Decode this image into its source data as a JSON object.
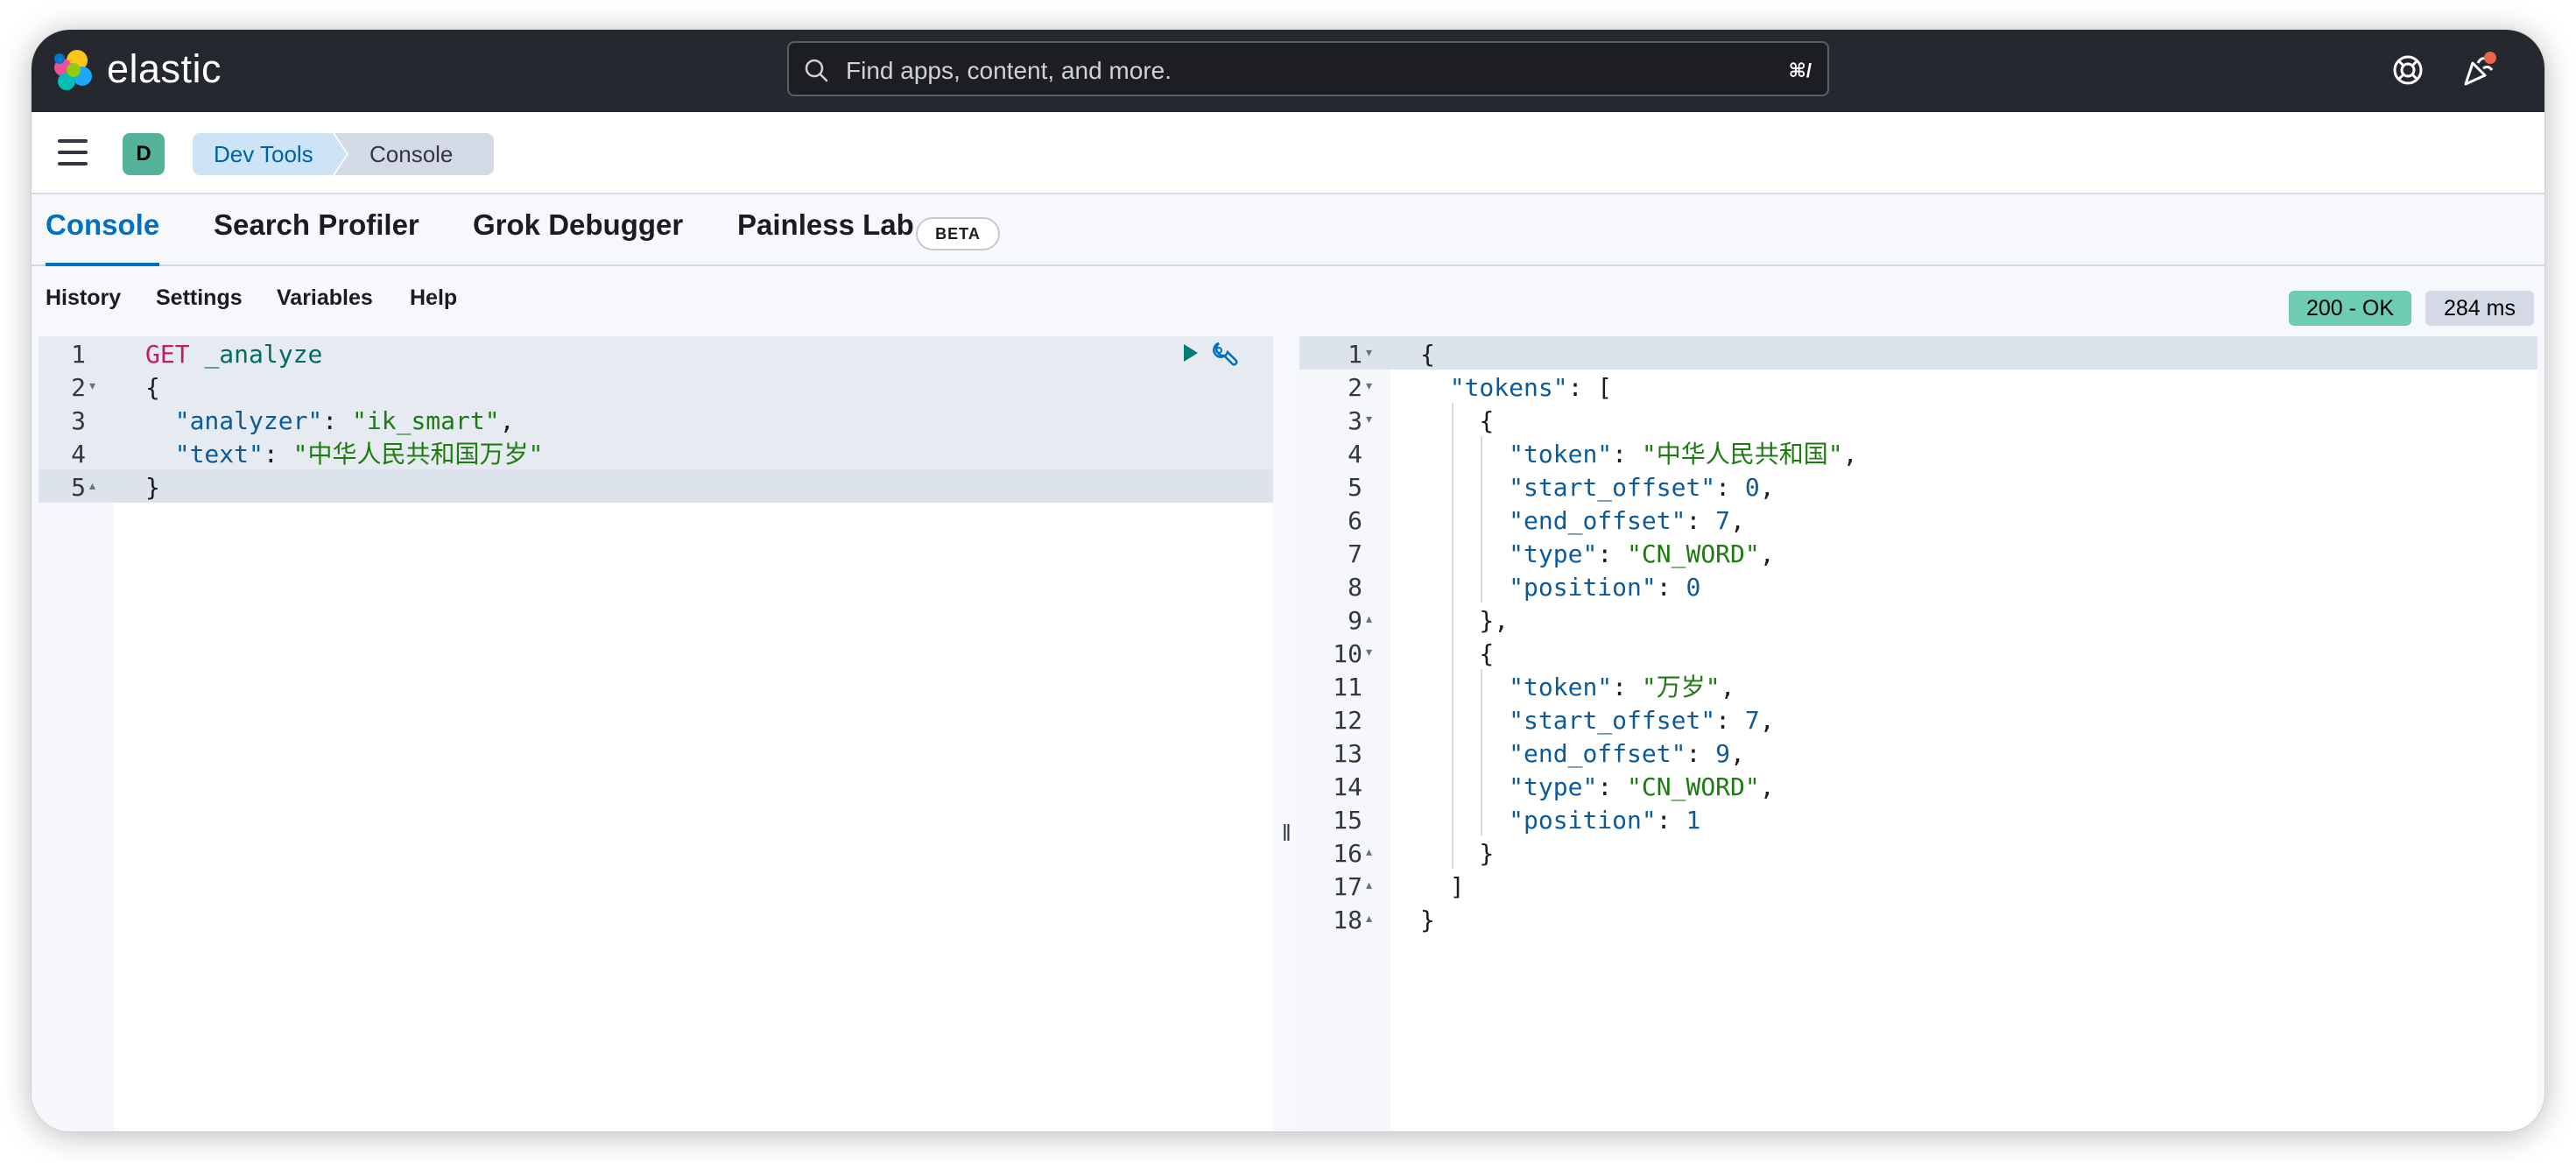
{
  "header": {
    "logo_text": "elastic",
    "search_placeholder": "Find apps, content, and more.",
    "search_shortcut": "⌘/",
    "colors": {
      "bar": "#25282f",
      "notification_dot": "#e7664c"
    }
  },
  "breadcrumb": {
    "space_initial": "D",
    "items": [
      "Dev Tools",
      "Console"
    ]
  },
  "tabs": [
    {
      "label": "Console",
      "active": true
    },
    {
      "label": "Search Profiler",
      "active": false
    },
    {
      "label": "Grok Debugger",
      "active": false
    },
    {
      "label": "Painless Lab",
      "active": false,
      "badge": "BETA"
    }
  ],
  "toolbar": {
    "items": [
      "History",
      "Settings",
      "Variables",
      "Help"
    ],
    "status_label": "200 - OK",
    "time_label": "284 ms",
    "colors": {
      "status": "#6dccb1",
      "time": "#d3dae6"
    }
  },
  "request_editor": {
    "line_numbers": [
      "1",
      "2",
      "3",
      "4",
      "5"
    ],
    "lines": [
      [
        {
          "t": "GET",
          "c": "k-method"
        },
        {
          "t": " ",
          "c": "k-punct"
        },
        {
          "t": "_analyze",
          "c": "k-path"
        }
      ],
      [
        {
          "t": "{",
          "c": "k-punct"
        }
      ],
      [
        {
          "t": "  ",
          "c": "k-punct"
        },
        {
          "t": "\"analyzer\"",
          "c": "k-key"
        },
        {
          "t": ": ",
          "c": "k-punct"
        },
        {
          "t": "\"ik_smart\"",
          "c": "k-str"
        },
        {
          "t": ",",
          "c": "k-punct"
        }
      ],
      [
        {
          "t": "  ",
          "c": "k-punct"
        },
        {
          "t": "\"text\"",
          "c": "k-key"
        },
        {
          "t": ": ",
          "c": "k-punct"
        },
        {
          "t": "\"中华人民共和国万岁\"",
          "c": "k-str"
        }
      ],
      [
        {
          "t": "}",
          "c": "k-punct"
        }
      ]
    ]
  },
  "response_editor": {
    "line_numbers": [
      "1",
      "2",
      "3",
      "4",
      "5",
      "6",
      "7",
      "8",
      "9",
      "10",
      "11",
      "12",
      "13",
      "14",
      "15",
      "16",
      "17",
      "18"
    ],
    "lines": [
      [
        {
          "t": "{",
          "c": "k-punct"
        }
      ],
      [
        {
          "t": "  ",
          "c": "k-punct"
        },
        {
          "t": "\"tokens\"",
          "c": "k-key"
        },
        {
          "t": ": [",
          "c": "k-punct"
        }
      ],
      [
        {
          "t": "    {",
          "c": "k-punct"
        }
      ],
      [
        {
          "t": "      ",
          "c": "k-punct"
        },
        {
          "t": "\"token\"",
          "c": "k-key"
        },
        {
          "t": ": ",
          "c": "k-punct"
        },
        {
          "t": "\"中华人民共和国\"",
          "c": "k-str"
        },
        {
          "t": ",",
          "c": "k-punct"
        }
      ],
      [
        {
          "t": "      ",
          "c": "k-punct"
        },
        {
          "t": "\"start_offset\"",
          "c": "k-key"
        },
        {
          "t": ": ",
          "c": "k-punct"
        },
        {
          "t": "0",
          "c": "k-num"
        },
        {
          "t": ",",
          "c": "k-punct"
        }
      ],
      [
        {
          "t": "      ",
          "c": "k-punct"
        },
        {
          "t": "\"end_offset\"",
          "c": "k-key"
        },
        {
          "t": ": ",
          "c": "k-punct"
        },
        {
          "t": "7",
          "c": "k-num"
        },
        {
          "t": ",",
          "c": "k-punct"
        }
      ],
      [
        {
          "t": "      ",
          "c": "k-punct"
        },
        {
          "t": "\"type\"",
          "c": "k-key"
        },
        {
          "t": ": ",
          "c": "k-punct"
        },
        {
          "t": "\"CN_WORD\"",
          "c": "k-str"
        },
        {
          "t": ",",
          "c": "k-punct"
        }
      ],
      [
        {
          "t": "      ",
          "c": "k-punct"
        },
        {
          "t": "\"position\"",
          "c": "k-key"
        },
        {
          "t": ": ",
          "c": "k-punct"
        },
        {
          "t": "0",
          "c": "k-num"
        }
      ],
      [
        {
          "t": "    },",
          "c": "k-punct"
        }
      ],
      [
        {
          "t": "    {",
          "c": "k-punct"
        }
      ],
      [
        {
          "t": "      ",
          "c": "k-punct"
        },
        {
          "t": "\"token\"",
          "c": "k-key"
        },
        {
          "t": ": ",
          "c": "k-punct"
        },
        {
          "t": "\"万岁\"",
          "c": "k-str"
        },
        {
          "t": ",",
          "c": "k-punct"
        }
      ],
      [
        {
          "t": "      ",
          "c": "k-punct"
        },
        {
          "t": "\"start_offset\"",
          "c": "k-key"
        },
        {
          "t": ": ",
          "c": "k-punct"
        },
        {
          "t": "7",
          "c": "k-num"
        },
        {
          "t": ",",
          "c": "k-punct"
        }
      ],
      [
        {
          "t": "      ",
          "c": "k-punct"
        },
        {
          "t": "\"end_offset\"",
          "c": "k-key"
        },
        {
          "t": ": ",
          "c": "k-punct"
        },
        {
          "t": "9",
          "c": "k-num"
        },
        {
          "t": ",",
          "c": "k-punct"
        }
      ],
      [
        {
          "t": "      ",
          "c": "k-punct"
        },
        {
          "t": "\"type\"",
          "c": "k-key"
        },
        {
          "t": ": ",
          "c": "k-punct"
        },
        {
          "t": "\"CN_WORD\"",
          "c": "k-str"
        },
        {
          "t": ",",
          "c": "k-punct"
        }
      ],
      [
        {
          "t": "      ",
          "c": "k-punct"
        },
        {
          "t": "\"position\"",
          "c": "k-key"
        },
        {
          "t": ": ",
          "c": "k-punct"
        },
        {
          "t": "1",
          "c": "k-num"
        }
      ],
      [
        {
          "t": "    }",
          "c": "k-punct"
        }
      ],
      [
        {
          "t": "  ]",
          "c": "k-punct"
        }
      ],
      [
        {
          "t": "}",
          "c": "k-punct"
        }
      ]
    ]
  },
  "icons": {
    "search": "search-icon",
    "help": "help-icon",
    "news": "newsfeed-icon",
    "menu": "hamburger-menu-icon",
    "run": "play-icon",
    "wrench": "wrench-icon",
    "resize": "resize-handle-icon"
  }
}
